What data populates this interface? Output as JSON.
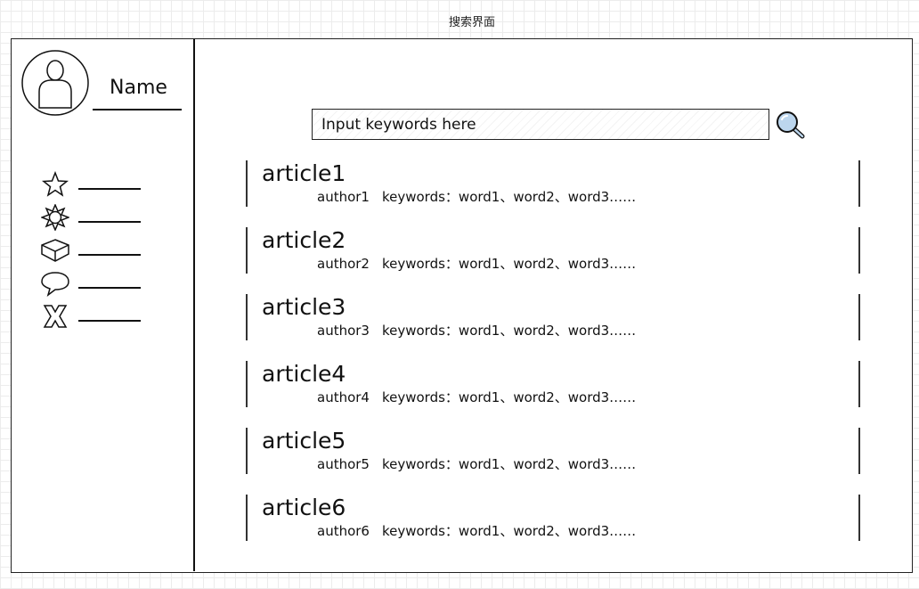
{
  "canvas_title": "搜索界面",
  "user": {
    "name": "Name",
    "avatar_icon": "person-avatar-icon"
  },
  "sidebar": {
    "items": [
      {
        "icon": "star-icon"
      },
      {
        "icon": "sun-icon"
      },
      {
        "icon": "cube-icon"
      },
      {
        "icon": "chat-bubble-icon"
      },
      {
        "icon": "x-icon"
      }
    ]
  },
  "search": {
    "placeholder": "Input keywords here",
    "value": "",
    "icon": "search-magnifier-icon"
  },
  "results": [
    {
      "title": "article1",
      "author": "author1",
      "keywords": "keywords：word1、word2、word3……"
    },
    {
      "title": "article2",
      "author": "author2",
      "keywords": "keywords：word1、word2、word3……"
    },
    {
      "title": "article3",
      "author": "author3",
      "keywords": "keywords：word1、word2、word3……"
    },
    {
      "title": "article4",
      "author": "author4",
      "keywords": "keywords：word1、word2、word3……"
    },
    {
      "title": "article5",
      "author": "author5",
      "keywords": "keywords：word1、word2、word3……"
    },
    {
      "title": "article6",
      "author": "author6",
      "keywords": "keywords：word1、word2、word3……"
    }
  ],
  "colors": {
    "line": "#111111",
    "search_icon_fill": "#bcd6ee"
  }
}
